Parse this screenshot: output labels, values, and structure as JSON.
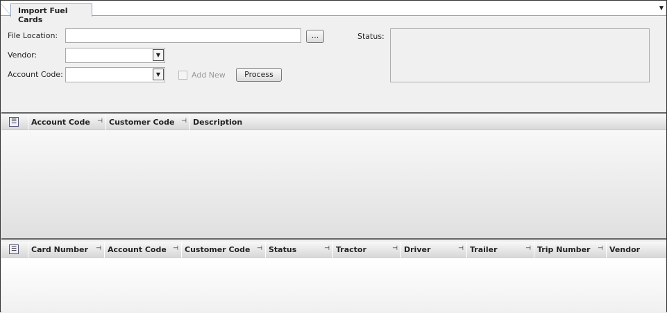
{
  "tab": {
    "title": "Import Fuel Cards"
  },
  "form": {
    "file_location_label": "File Location:",
    "file_location_value": "",
    "browse_label": "...",
    "vendor_label": "Vendor:",
    "vendor_value": "",
    "account_code_label": "Account Code:",
    "account_code_value": "",
    "add_new_label": "Add New",
    "add_new_checked": false,
    "process_label": "Process",
    "status_label": "Status:",
    "status_value": ""
  },
  "grid1": {
    "columns": [
      "Account Code",
      "Customer Code",
      "Description"
    ],
    "rows": []
  },
  "grid2": {
    "columns": [
      "Card Number",
      "Account Code",
      "Customer Code",
      "Status",
      "Tractor",
      "Driver",
      "Trailer",
      "Trip Number",
      "Vendor"
    ],
    "rows": []
  }
}
